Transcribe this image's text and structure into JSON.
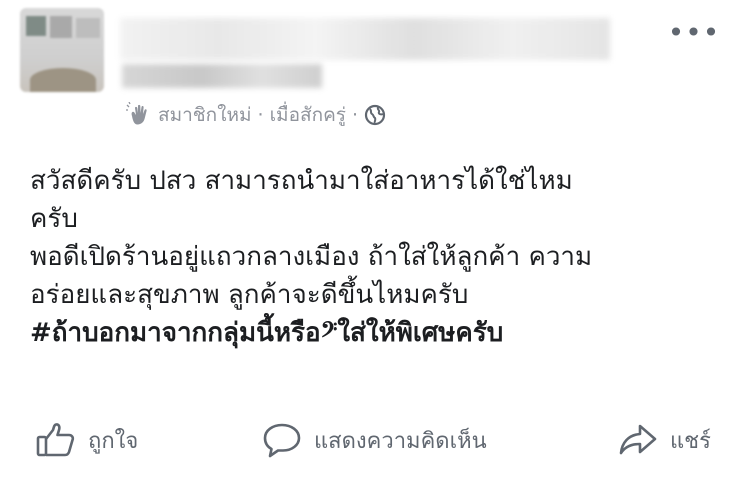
{
  "post": {
    "more_label": "•••",
    "meta": {
      "badge": "สมาชิกใหม่",
      "separator": "·",
      "time": "เมื่อสักครู่",
      "separator2": "·",
      "icons": [
        "wave-hand-icon",
        "globe-icon"
      ]
    },
    "text_lines": [
      "สวัสดีครับ ปสว สามารถนำมาใส่อาหารได้ใช่ไหม",
      "ครับ",
      "พอดีเปิดร้านอยู่แถวกลางเมือง ถ้าใส่ให้ลูกค้า ความ",
      "อร่อยและสุขภาพ ลูกค้าจะดีขึ้นไหมครับ"
    ],
    "hashtag": "#ถ้าบอกมาจากกลุ่มนี้หรือ𝄢ใส่ให้พิเศษครับ"
  },
  "actions": {
    "like": "ถูกใจ",
    "comment": "แสดงความคิดเห็น",
    "share": "แชร์"
  },
  "colors": {
    "text": "#1c1e21",
    "secondary": "#606770",
    "meta": "#90949c"
  }
}
